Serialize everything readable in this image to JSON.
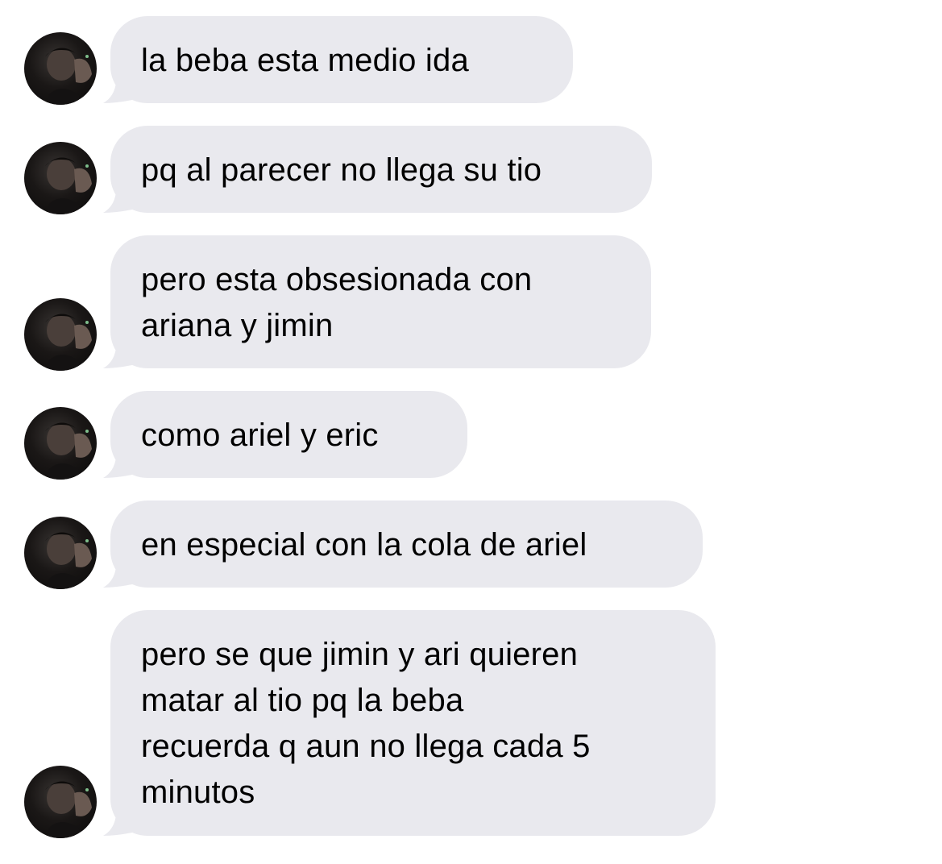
{
  "conversation": {
    "bubble_color": "#e9e9ee",
    "text_color": "#000000",
    "messages": [
      {
        "text": "la beba esta medio ida"
      },
      {
        "text": "pq al parecer no llega su tio"
      },
      {
        "text": "pero esta obsesionada con\nariana y jimin"
      },
      {
        "text": "como ariel y eric"
      },
      {
        "text": "en especial con la cola de ariel"
      },
      {
        "text": "pero se que jimin y ari quieren\nmatar al tio pq la beba\nrecuerda q aun no llega cada 5\nminutos"
      }
    ]
  }
}
